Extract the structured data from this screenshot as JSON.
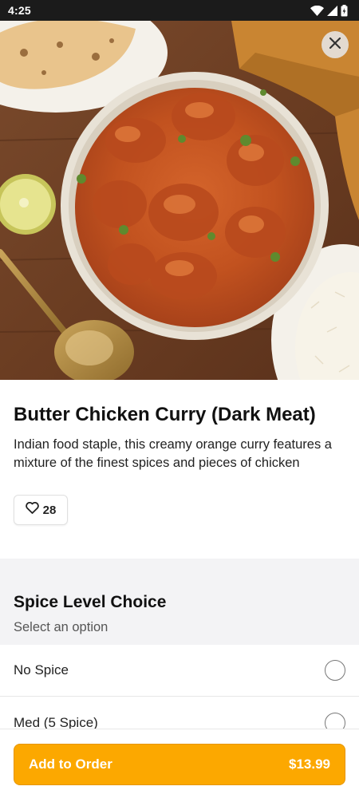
{
  "status_bar": {
    "time": "4:25"
  },
  "item": {
    "title": "Butter Chicken Curry (Dark Meat)",
    "description": "Indian food staple, this creamy orange curry features a mixture of the finest spices and pieces of chicken",
    "likes": "28"
  },
  "options": {
    "title": "Spice Level Choice",
    "subtitle": "Select an option",
    "items": [
      {
        "label": "No Spice",
        "selected": false
      },
      {
        "label": "Med (5 Spice)",
        "selected": false
      }
    ]
  },
  "bottom_bar": {
    "add_label": "Add to Order",
    "price": "$13.99"
  },
  "colors": {
    "accent": "#fca800",
    "section_bg": "#f3f3f5",
    "status_bar_bg": "#1b1b1b"
  },
  "icons": [
    "wifi-icon",
    "signal-icon",
    "battery-icon",
    "close-icon",
    "heart-icon",
    "radio-icon"
  ]
}
